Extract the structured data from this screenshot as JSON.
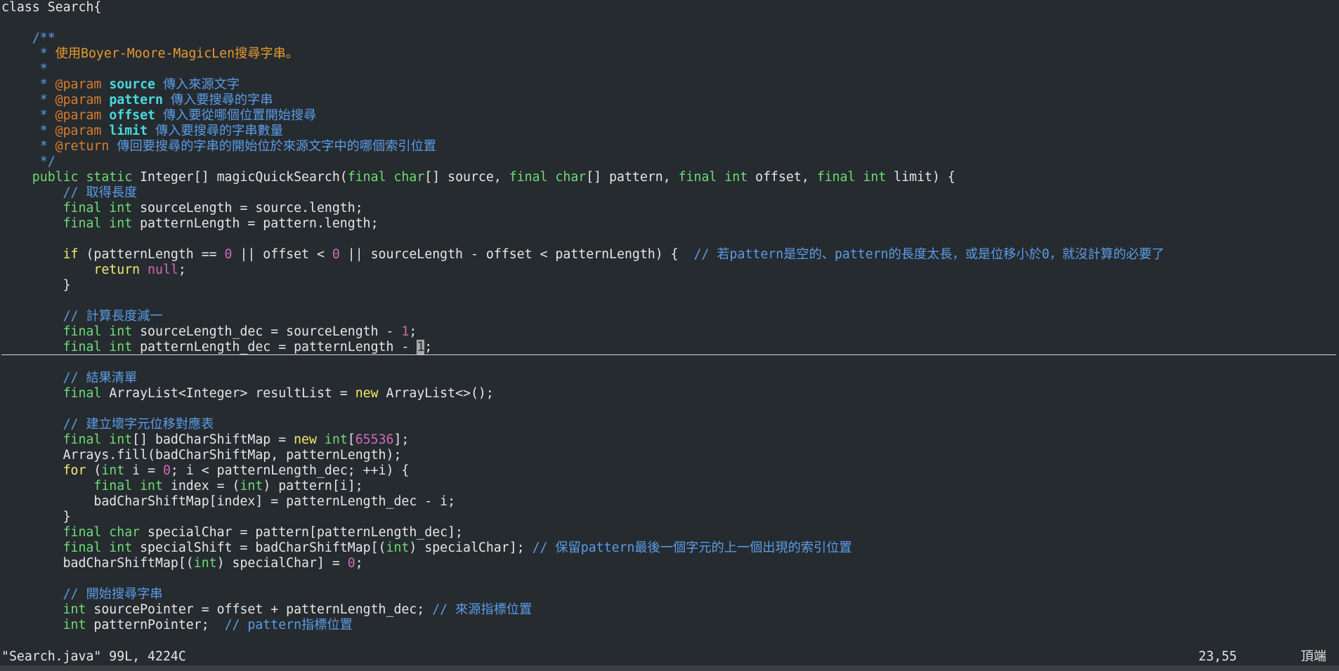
{
  "editor": {
    "theme": {
      "background": "#262b30",
      "plain": "#e6e6e6",
      "keyword": "#f0ec6a",
      "type": "#6ddc74",
      "number": "#d06ab6",
      "comment": "#5b9ce6",
      "doc_text": "#e79a2e",
      "doc_param": "#48dbdf"
    },
    "lines": [
      [
        {
          "c": "plain",
          "t": "class Search{"
        }
      ],
      [],
      [
        {
          "c": "comment",
          "t": "    /**"
        }
      ],
      [
        {
          "c": "comment",
          "t": "     * "
        },
        {
          "c": "doctext",
          "t": "使用Boyer-Moore-MagicLen搜尋字串。"
        }
      ],
      [
        {
          "c": "comment",
          "t": "     *"
        }
      ],
      [
        {
          "c": "comment",
          "t": "     * "
        },
        {
          "c": "doctag",
          "t": "@param "
        },
        {
          "c": "docparam",
          "t": "source"
        },
        {
          "c": "comment",
          "t": " 傳入來源文字"
        }
      ],
      [
        {
          "c": "comment",
          "t": "     * "
        },
        {
          "c": "doctag",
          "t": "@param "
        },
        {
          "c": "docparam",
          "t": "pattern"
        },
        {
          "c": "comment",
          "t": " 傳入要搜尋的字串"
        }
      ],
      [
        {
          "c": "comment",
          "t": "     * "
        },
        {
          "c": "doctag",
          "t": "@param "
        },
        {
          "c": "docparam",
          "t": "offset"
        },
        {
          "c": "comment",
          "t": " 傳入要從哪個位置開始搜尋"
        }
      ],
      [
        {
          "c": "comment",
          "t": "     * "
        },
        {
          "c": "doctag",
          "t": "@param "
        },
        {
          "c": "docparam",
          "t": "limit"
        },
        {
          "c": "comment",
          "t": " 傳入要搜尋的字串數量"
        }
      ],
      [
        {
          "c": "comment",
          "t": "     * "
        },
        {
          "c": "doctag",
          "t": "@return"
        },
        {
          "c": "comment",
          "t": " 傳回要搜尋的字串的開始位於來源文字中的哪個索引位置"
        }
      ],
      [
        {
          "c": "comment",
          "t": "     */"
        }
      ],
      [
        {
          "c": "type",
          "t": "    public static "
        },
        {
          "c": "plain",
          "t": "Integer[] magicQuickSearch("
        },
        {
          "c": "type",
          "t": "final char"
        },
        {
          "c": "plain",
          "t": "[] source, "
        },
        {
          "c": "type",
          "t": "final char"
        },
        {
          "c": "plain",
          "t": "[] pattern, "
        },
        {
          "c": "type",
          "t": "final int"
        },
        {
          "c": "plain",
          "t": " offset, "
        },
        {
          "c": "type",
          "t": "final int"
        },
        {
          "c": "plain",
          "t": " limit) {"
        }
      ],
      [
        {
          "c": "comment",
          "t": "        // 取得長度"
        }
      ],
      [
        {
          "c": "type",
          "t": "        final int"
        },
        {
          "c": "plain",
          "t": " sourceLength = source.length;"
        }
      ],
      [
        {
          "c": "type",
          "t": "        final int"
        },
        {
          "c": "plain",
          "t": " patternLength = pattern.length;"
        }
      ],
      [],
      [
        {
          "c": "keyword",
          "t": "        if"
        },
        {
          "c": "plain",
          "t": " (patternLength == "
        },
        {
          "c": "number",
          "t": "0"
        },
        {
          "c": "plain",
          "t": " || offset < "
        },
        {
          "c": "number",
          "t": "0"
        },
        {
          "c": "plain",
          "t": " || sourceLength - offset < patternLength) {  "
        },
        {
          "c": "comment",
          "t": "// 若pattern是空的、pattern的長度太長，或是位移小於0，就沒計算的必要了"
        }
      ],
      [
        {
          "c": "keyword",
          "t": "            return "
        },
        {
          "c": "number",
          "t": "null"
        },
        {
          "c": "plain",
          "t": ";"
        }
      ],
      [
        {
          "c": "plain",
          "t": "        }"
        }
      ],
      [],
      [
        {
          "c": "comment",
          "t": "        // 計算長度減一"
        }
      ],
      [
        {
          "c": "type",
          "t": "        final int"
        },
        {
          "c": "plain",
          "t": " sourceLength_dec = sourceLength - "
        },
        {
          "c": "number",
          "t": "1"
        },
        {
          "c": "plain",
          "t": ";"
        }
      ],
      [
        {
          "c": "type",
          "t": "        final int"
        },
        {
          "c": "plain",
          "t": " patternLength_dec = patternLength - "
        },
        {
          "c": "cursor",
          "t": "1"
        },
        {
          "c": "plain",
          "t": ";"
        }
      ],
      [],
      [
        {
          "c": "comment",
          "t": "        // 結果清單"
        }
      ],
      [
        {
          "c": "type",
          "t": "        final "
        },
        {
          "c": "plain",
          "t": "ArrayList<Integer> resultList = "
        },
        {
          "c": "keyword",
          "t": "new"
        },
        {
          "c": "plain",
          "t": " ArrayList<>();"
        }
      ],
      [],
      [
        {
          "c": "comment",
          "t": "        // 建立壞字元位移對應表"
        }
      ],
      [
        {
          "c": "type",
          "t": "        final int"
        },
        {
          "c": "plain",
          "t": "[] badCharShiftMap = "
        },
        {
          "c": "keyword",
          "t": "new "
        },
        {
          "c": "type",
          "t": "int"
        },
        {
          "c": "plain",
          "t": "["
        },
        {
          "c": "number",
          "t": "65536"
        },
        {
          "c": "plain",
          "t": "];"
        }
      ],
      [
        {
          "c": "plain",
          "t": "        Arrays.fill(badCharShiftMap, patternLength);"
        }
      ],
      [
        {
          "c": "keyword",
          "t": "        for"
        },
        {
          "c": "plain",
          "t": " ("
        },
        {
          "c": "type",
          "t": "int"
        },
        {
          "c": "plain",
          "t": " i = "
        },
        {
          "c": "number",
          "t": "0"
        },
        {
          "c": "plain",
          "t": "; i < patternLength_dec; ++i) {"
        }
      ],
      [
        {
          "c": "type",
          "t": "            final int"
        },
        {
          "c": "plain",
          "t": " index = ("
        },
        {
          "c": "type",
          "t": "int"
        },
        {
          "c": "plain",
          "t": ") pattern[i];"
        }
      ],
      [
        {
          "c": "plain",
          "t": "            badCharShiftMap[index] = patternLength_dec - i;"
        }
      ],
      [
        {
          "c": "plain",
          "t": "        }"
        }
      ],
      [
        {
          "c": "type",
          "t": "        final char"
        },
        {
          "c": "plain",
          "t": " specialChar = pattern[patternLength_dec];"
        }
      ],
      [
        {
          "c": "type",
          "t": "        final int"
        },
        {
          "c": "plain",
          "t": " specialShift = badCharShiftMap[("
        },
        {
          "c": "type",
          "t": "int"
        },
        {
          "c": "plain",
          "t": ") specialChar]; "
        },
        {
          "c": "comment",
          "t": "// 保留pattern最後一個字元的上一個出現的索引位置"
        }
      ],
      [
        {
          "c": "plain",
          "t": "        badCharShiftMap[("
        },
        {
          "c": "type",
          "t": "int"
        },
        {
          "c": "plain",
          "t": ") specialChar] = "
        },
        {
          "c": "number",
          "t": "0"
        },
        {
          "c": "plain",
          "t": ";"
        }
      ],
      [],
      [
        {
          "c": "comment",
          "t": "        // 開始搜尋字串"
        }
      ],
      [
        {
          "c": "type",
          "t": "        int"
        },
        {
          "c": "plain",
          "t": " sourcePointer = offset + patternLength_dec; "
        },
        {
          "c": "comment",
          "t": "// 來源指標位置"
        }
      ],
      [
        {
          "c": "type",
          "t": "        int"
        },
        {
          "c": "plain",
          "t": " patternPointer;  "
        },
        {
          "c": "comment",
          "t": "// pattern指標位置"
        }
      ]
    ]
  },
  "statusline": {
    "file_info": "\"Search.java\" 99L, 4224C",
    "cursor_position": "23,55",
    "scroll_position": "頂端"
  }
}
